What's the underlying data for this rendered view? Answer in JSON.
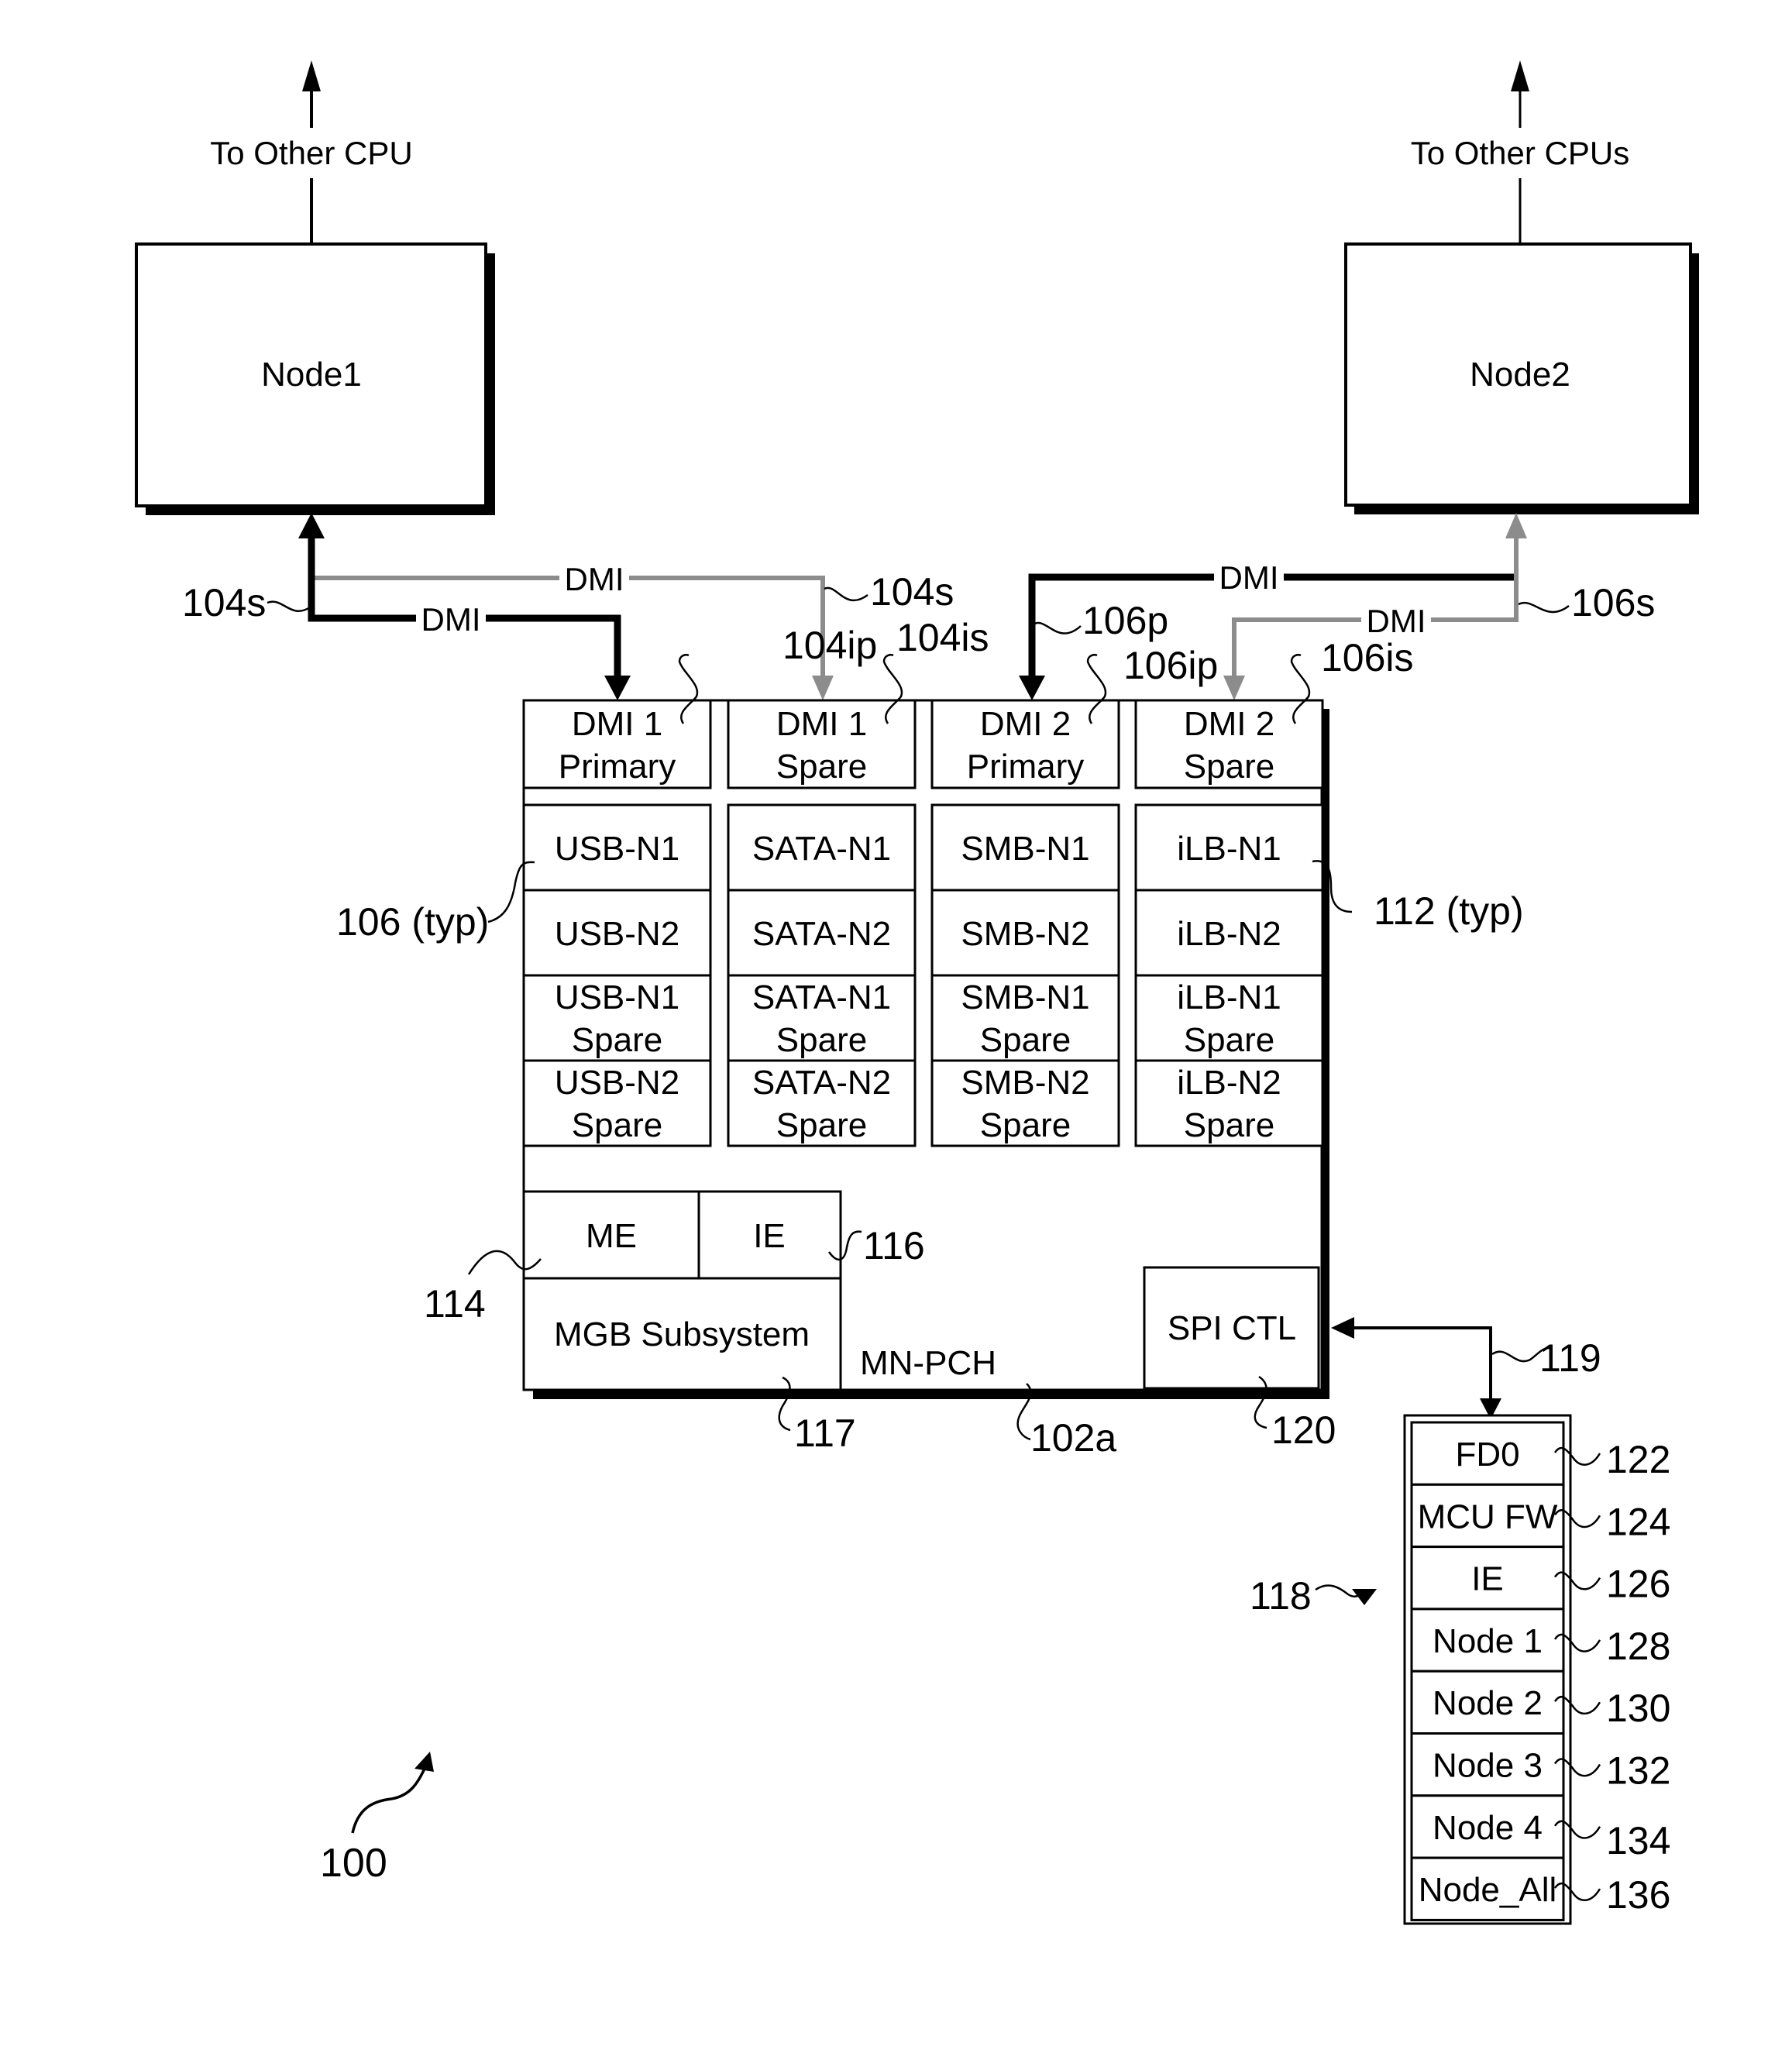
{
  "figure": {
    "reference": "100",
    "colors": {
      "primary_link": "#000000",
      "spare_link": "#8c8c8c",
      "background": "#ffffff"
    }
  },
  "nodes": {
    "node1": {
      "label": "Node1",
      "uplink_label": "To Other CPU"
    },
    "node2": {
      "label": "Node2",
      "uplink_label": "To Other CPUs"
    }
  },
  "links": {
    "dmi_label": "DMI",
    "refs": {
      "node1_spare": "104s",
      "node1_spare_right": "104s",
      "node2_primary": "106p",
      "node2_spare": "106s"
    }
  },
  "pch": {
    "label": "MN-PCH",
    "ref": "102a",
    "dmi_ports": [
      {
        "line1": "DMI 1",
        "line2": "Primary",
        "ref": "104ip"
      },
      {
        "line1": "DMI 1",
        "line2": "Spare",
        "ref": "104is"
      },
      {
        "line1": "DMI 2",
        "line2": "Primary",
        "ref": "106ip"
      },
      {
        "line1": "DMI 2",
        "line2": "Spare",
        "ref": "106is"
      }
    ],
    "peripheral_columns": [
      {
        "cells": [
          [
            "USB-N1"
          ],
          [
            "USB-N2"
          ],
          [
            "USB-N1",
            "Spare"
          ],
          [
            "USB-N2",
            "Spare"
          ]
        ]
      },
      {
        "cells": [
          [
            "SATA-N1"
          ],
          [
            "SATA-N2"
          ],
          [
            "SATA-N1",
            "Spare"
          ],
          [
            "SATA-N2",
            "Spare"
          ]
        ]
      },
      {
        "cells": [
          [
            "SMB-N1"
          ],
          [
            "SMB-N2"
          ],
          [
            "SMB-N1",
            "Spare"
          ],
          [
            "SMB-N2",
            "Spare"
          ]
        ]
      },
      {
        "cells": [
          [
            "iLB-N1"
          ],
          [
            "iLB-N2"
          ],
          [
            "iLB-N1",
            "Spare"
          ],
          [
            "iLB-N2",
            "Spare"
          ]
        ]
      }
    ],
    "peripheral_refs": {
      "left": "106 (typ)",
      "right": "112 (typ)"
    },
    "engines": {
      "me": "ME",
      "ie": "IE",
      "me_ref": "114",
      "ie_ref": "116",
      "mgb": "MGB Subsystem",
      "mgb_ref": "117"
    },
    "spi": {
      "label": "SPI CTL",
      "ref": "120",
      "link_ref": "119"
    }
  },
  "flash": {
    "ref": "118",
    "regions": [
      {
        "label": "FD0",
        "ref": "122"
      },
      {
        "label": "MCU FW",
        "ref": "124"
      },
      {
        "label": "IE",
        "ref": "126"
      },
      {
        "label": "Node 1",
        "ref": "128"
      },
      {
        "label": "Node 2",
        "ref": "130"
      },
      {
        "label": "Node 3",
        "ref": "132"
      },
      {
        "label": "Node 4",
        "ref": "134"
      },
      {
        "label": "Node_All",
        "ref": "136"
      }
    ]
  }
}
